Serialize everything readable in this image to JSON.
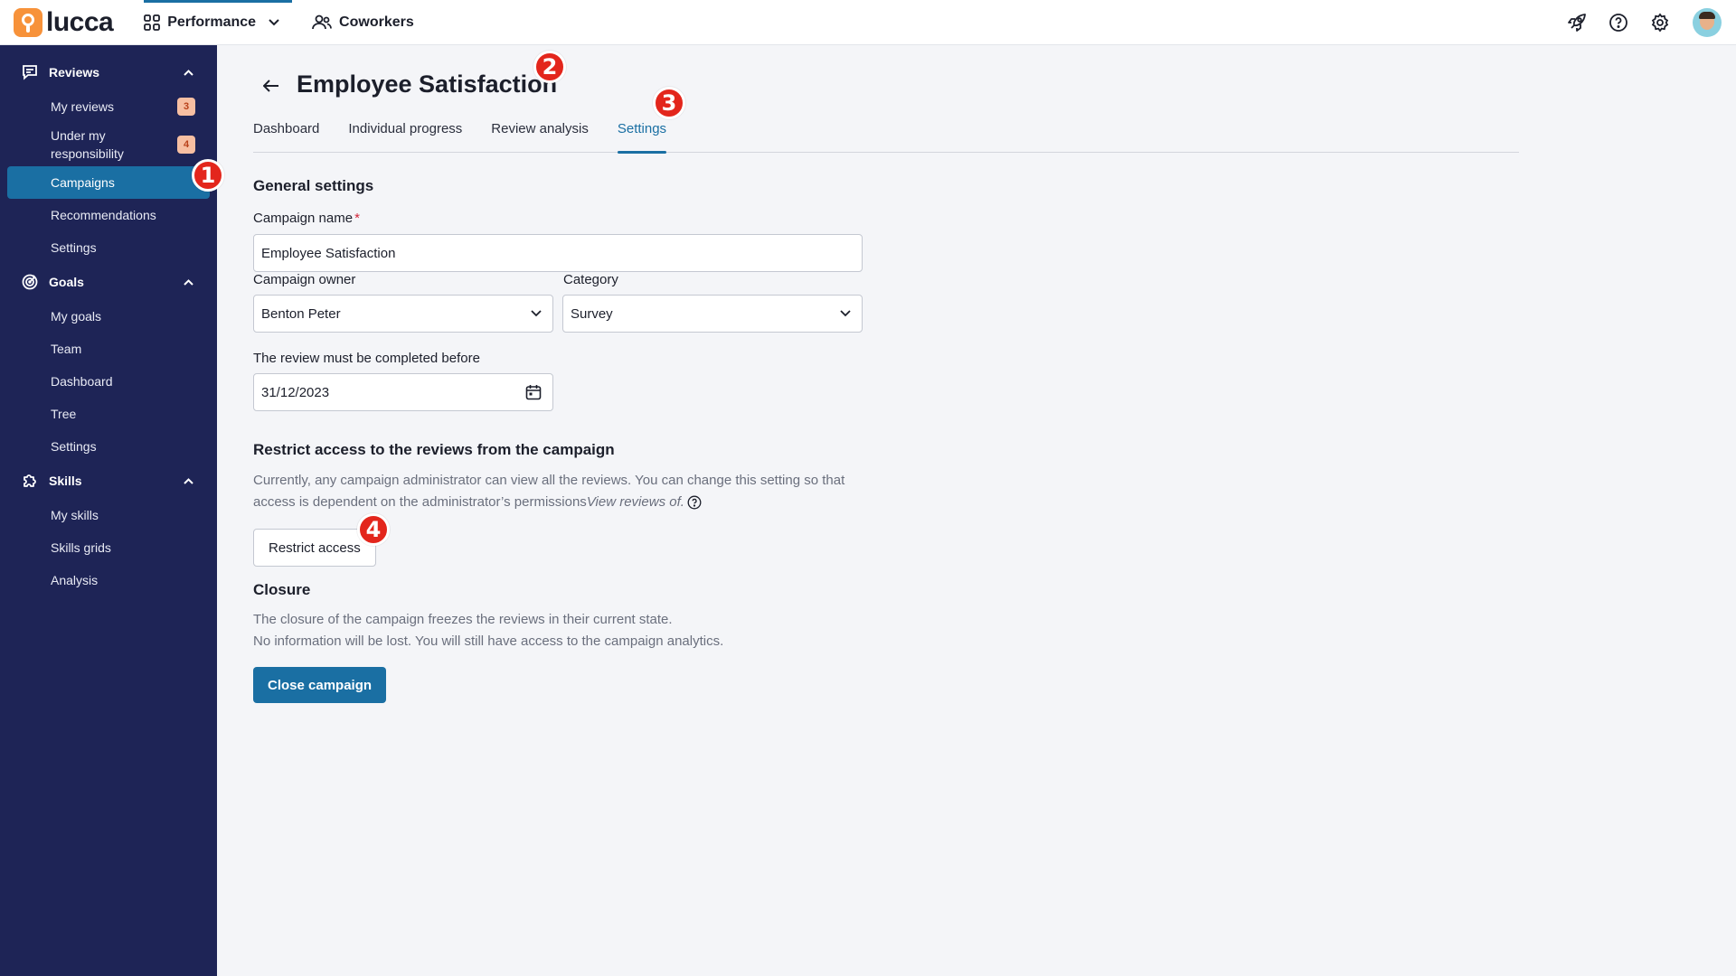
{
  "brand": {
    "name": "lucca",
    "accent": "#1a6fa3",
    "sidebar_bg": "#1e2456"
  },
  "topnav": {
    "items": [
      {
        "label": "Performance",
        "icon": "apps-grid-icon",
        "active": true
      },
      {
        "label": "Coworkers",
        "icon": "people-icon",
        "active": false
      }
    ],
    "right_icons": [
      "rocket-icon",
      "help-icon",
      "gear-icon",
      "avatar"
    ]
  },
  "sidebar": {
    "sections": [
      {
        "label": "Reviews",
        "icon": "reviews-icon",
        "items": [
          {
            "label": "My reviews",
            "badge": "3"
          },
          {
            "label": "Under my responsibility",
            "badge": "4"
          },
          {
            "label": "Campaigns",
            "active": true
          },
          {
            "label": "Recommendations"
          },
          {
            "label": "Settings"
          }
        ]
      },
      {
        "label": "Goals",
        "icon": "target-icon",
        "items": [
          {
            "label": "My goals"
          },
          {
            "label": "Team"
          },
          {
            "label": "Dashboard"
          },
          {
            "label": "Tree"
          },
          {
            "label": "Settings"
          }
        ]
      },
      {
        "label": "Skills",
        "icon": "puzzle-icon",
        "items": [
          {
            "label": "My skills"
          },
          {
            "label": "Skills grids"
          },
          {
            "label": "Analysis"
          }
        ]
      }
    ]
  },
  "page": {
    "title": "Employee Satisfaction",
    "tabs": [
      {
        "label": "Dashboard"
      },
      {
        "label": "Individual progress"
      },
      {
        "label": "Review analysis"
      },
      {
        "label": "Settings",
        "active": true
      }
    ]
  },
  "general": {
    "heading": "General settings",
    "campaign_name_label": "Campaign name",
    "required_mark": "*",
    "campaign_name_value": "Employee Satisfaction",
    "owner_label": "Campaign owner",
    "owner_value": "Benton Peter",
    "category_label": "Category",
    "category_value": "Survey",
    "deadline_label": "The review must be completed before",
    "deadline_value": "31/12/2023"
  },
  "restrict": {
    "heading": "Restrict access to the reviews from the campaign",
    "desc_line1": "Currently, any campaign administrator can view all the reviews. You can change this setting so that",
    "desc_line2": "access is dependent on the administrator’s permissions",
    "desc_italic": "View reviews of.",
    "button_label": "Restrict access"
  },
  "closure": {
    "heading": "Closure",
    "desc_line1": "The closure of the campaign freezes the reviews in their current state.",
    "desc_line2": "No information will be lost. You will still have access to the campaign analytics.",
    "button_label": "Close campaign"
  },
  "markers": [
    "1",
    "2",
    "3",
    "4"
  ]
}
